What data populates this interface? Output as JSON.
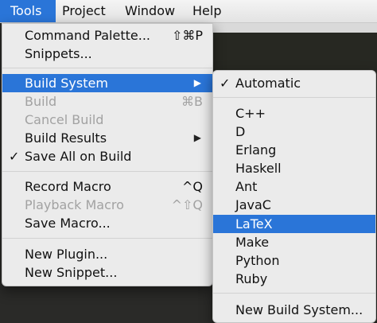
{
  "menubar": {
    "items": [
      {
        "label": "Tools"
      },
      {
        "label": "Project"
      },
      {
        "label": "Window"
      },
      {
        "label": "Help"
      }
    ]
  },
  "tools_menu": {
    "items": [
      {
        "label": "Command Palette...",
        "shortcut": "⇧⌘P"
      },
      {
        "label": "Snippets..."
      },
      {
        "label": "Build System"
      },
      {
        "label": "Build",
        "shortcut": "⌘B"
      },
      {
        "label": "Cancel Build"
      },
      {
        "label": "Build Results"
      },
      {
        "label": "Save All on Build",
        "check": "✓"
      },
      {
        "label": "Record Macro",
        "shortcut": "^Q"
      },
      {
        "label": "Playback Macro",
        "shortcut": "^⇧Q"
      },
      {
        "label": "Save Macro..."
      },
      {
        "label": "New Plugin..."
      },
      {
        "label": "New Snippet..."
      }
    ],
    "arrow": "▶"
  },
  "build_system_menu": {
    "items": [
      {
        "label": "Automatic",
        "check": "✓"
      },
      {
        "label": "C++"
      },
      {
        "label": "D"
      },
      {
        "label": "Erlang"
      },
      {
        "label": "Haskell"
      },
      {
        "label": "Ant"
      },
      {
        "label": "JavaC"
      },
      {
        "label": "LaTeX"
      },
      {
        "label": "Make"
      },
      {
        "label": "Python"
      },
      {
        "label": "Ruby"
      },
      {
        "label": "New Build System..."
      }
    ]
  },
  "colors": {
    "highlight": "#2a75d8",
    "menu_background": "#ebebeb",
    "disabled_text": "#a2a2a2",
    "editor_background": "#272822"
  }
}
